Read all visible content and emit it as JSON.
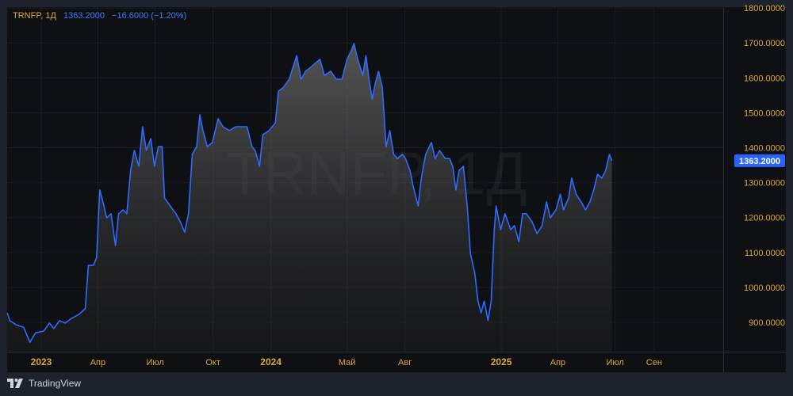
{
  "legend": {
    "symbol": "TRNFP, 1Д",
    "price": "1363.2000",
    "change": "−16.6000 (−1.20%)"
  },
  "watermark": "TRNFP, 1Д",
  "brand": "TradingView",
  "colors": {
    "line": "#2f6bff",
    "axis_text": "#d9a93a",
    "badge": "#2962ff",
    "background": "#0f1013",
    "frame": "#1e222d"
  },
  "chart_data": {
    "type": "area",
    "title": "TRNFP, 1Д",
    "x_unit": "days since 2023-01-01",
    "ylim": [
      830,
      1810
    ],
    "xlim": [
      -54,
      1000
    ],
    "grid": true,
    "last_price_label": "1363.2000",
    "y_ticks": [
      {
        "value": 900,
        "label": "900.0000"
      },
      {
        "value": 1000,
        "label": "1000.0000"
      },
      {
        "value": 1100,
        "label": "1100.0000"
      },
      {
        "value": 1200,
        "label": "1200.0000"
      },
      {
        "value": 1300,
        "label": "1300.0000"
      },
      {
        "value": 1400,
        "label": "1400.0000"
      },
      {
        "value": 1500,
        "label": "1500.0000"
      },
      {
        "value": 1600,
        "label": "1600.0000"
      },
      {
        "value": 1700,
        "label": "1700.0000"
      },
      {
        "value": 1800,
        "label": "1800.0000"
      }
    ],
    "x_ticks": [
      {
        "value": 0,
        "label": "2023",
        "major": true
      },
      {
        "value": 90,
        "label": "Апр"
      },
      {
        "value": 181,
        "label": "Июл"
      },
      {
        "value": 273,
        "label": "Окт"
      },
      {
        "value": 365,
        "label": "2024",
        "major": true
      },
      {
        "value": 486,
        "label": "Май"
      },
      {
        "value": 578,
        "label": "Авг"
      },
      {
        "value": 731,
        "label": "2025",
        "major": true
      },
      {
        "value": 821,
        "label": "Апр"
      },
      {
        "value": 912,
        "label": "Июл"
      },
      {
        "value": 974,
        "label": "Сен"
      }
    ],
    "points": [
      [
        -54,
        927
      ],
      [
        -50,
        905
      ],
      [
        -40,
        893
      ],
      [
        -28,
        886
      ],
      [
        -18,
        843
      ],
      [
        -9,
        870
      ],
      [
        4,
        875
      ],
      [
        13,
        898
      ],
      [
        20,
        882
      ],
      [
        29,
        905
      ],
      [
        38,
        898
      ],
      [
        48,
        911
      ],
      [
        60,
        923
      ],
      [
        70,
        939
      ],
      [
        75,
        1063
      ],
      [
        83,
        1063
      ],
      [
        88,
        1086
      ],
      [
        93,
        1279
      ],
      [
        98,
        1245
      ],
      [
        104,
        1199
      ],
      [
        111,
        1211
      ],
      [
        118,
        1120
      ],
      [
        123,
        1211
      ],
      [
        130,
        1222
      ],
      [
        136,
        1211
      ],
      [
        142,
        1335
      ],
      [
        148,
        1392
      ],
      [
        155,
        1347
      ],
      [
        161,
        1460
      ],
      [
        167,
        1392
      ],
      [
        174,
        1426
      ],
      [
        180,
        1347
      ],
      [
        186,
        1403
      ],
      [
        192,
        1403
      ],
      [
        196,
        1256
      ],
      [
        205,
        1233
      ],
      [
        214,
        1211
      ],
      [
        221,
        1188
      ],
      [
        228,
        1158
      ],
      [
        234,
        1211
      ],
      [
        240,
        1381
      ],
      [
        247,
        1403
      ],
      [
        252,
        1494
      ],
      [
        257,
        1449
      ],
      [
        264,
        1403
      ],
      [
        272,
        1415
      ],
      [
        281,
        1483
      ],
      [
        289,
        1460
      ],
      [
        299,
        1449
      ],
      [
        309,
        1460
      ],
      [
        318,
        1460
      ],
      [
        327,
        1460
      ],
      [
        335,
        1403
      ],
      [
        340,
        1392
      ],
      [
        347,
        1347
      ],
      [
        352,
        1437
      ],
      [
        362,
        1449
      ],
      [
        372,
        1471
      ],
      [
        377,
        1562
      ],
      [
        385,
        1573
      ],
      [
        394,
        1596
      ],
      [
        400,
        1630
      ],
      [
        406,
        1664
      ],
      [
        413,
        1596
      ],
      [
        420,
        1619
      ],
      [
        428,
        1630
      ],
      [
        435,
        1641
      ],
      [
        443,
        1653
      ],
      [
        450,
        1607
      ],
      [
        460,
        1619
      ],
      [
        469,
        1596
      ],
      [
        478,
        1596
      ],
      [
        486,
        1653
      ],
      [
        492,
        1675
      ],
      [
        497,
        1698
      ],
      [
        503,
        1653
      ],
      [
        511,
        1607
      ],
      [
        516,
        1664
      ],
      [
        521,
        1596
      ],
      [
        526,
        1539
      ],
      [
        531,
        1585
      ],
      [
        536,
        1619
      ],
      [
        542,
        1573
      ],
      [
        546,
        1460
      ],
      [
        548,
        1403
      ],
      [
        554,
        1449
      ],
      [
        560,
        1381
      ],
      [
        566,
        1369
      ],
      [
        574,
        1381
      ],
      [
        579,
        1369
      ],
      [
        586,
        1335
      ],
      [
        591,
        1290
      ],
      [
        599,
        1233
      ],
      [
        604,
        1313
      ],
      [
        611,
        1381
      ],
      [
        620,
        1415
      ],
      [
        626,
        1369
      ],
      [
        633,
        1392
      ],
      [
        642,
        1369
      ],
      [
        649,
        1369
      ],
      [
        654,
        1347
      ],
      [
        659,
        1279
      ],
      [
        664,
        1335
      ],
      [
        671,
        1347
      ],
      [
        677,
        1233
      ],
      [
        682,
        1097
      ],
      [
        689,
        1041
      ],
      [
        694,
        961
      ],
      [
        699,
        927
      ],
      [
        704,
        961
      ],
      [
        710,
        905
      ],
      [
        715,
        961
      ],
      [
        720,
        1165
      ],
      [
        723,
        1233
      ],
      [
        730,
        1165
      ],
      [
        737,
        1211
      ],
      [
        746,
        1165
      ],
      [
        752,
        1177
      ],
      [
        759,
        1131
      ],
      [
        765,
        1211
      ],
      [
        771,
        1211
      ],
      [
        780,
        1188
      ],
      [
        788,
        1154
      ],
      [
        796,
        1177
      ],
      [
        803,
        1245
      ],
      [
        809,
        1199
      ],
      [
        818,
        1222
      ],
      [
        825,
        1267
      ],
      [
        830,
        1222
      ],
      [
        838,
        1256
      ],
      [
        843,
        1313
      ],
      [
        850,
        1267
      ],
      [
        858,
        1245
      ],
      [
        865,
        1222
      ],
      [
        872,
        1245
      ],
      [
        878,
        1279
      ],
      [
        884,
        1324
      ],
      [
        891,
        1313
      ],
      [
        897,
        1335
      ],
      [
        903,
        1381
      ],
      [
        907,
        1363
      ]
    ]
  }
}
